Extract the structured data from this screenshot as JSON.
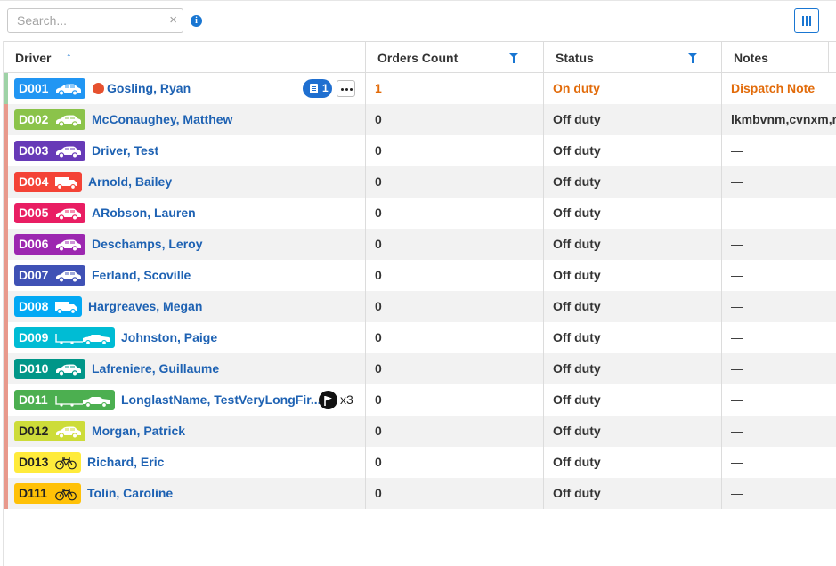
{
  "toolbar": {
    "search_placeholder": "Search...",
    "clear_glyph": "×",
    "info_glyph": "i",
    "info_icon": "info-icon",
    "columns_icon": "columns-icon"
  },
  "colors": {
    "accent": "#1976d2",
    "orange": "#e26b0a",
    "link": "#1e62b3",
    "stripe_on": "#9ed2a6",
    "stripe_off": "#e8998c"
  },
  "columns": [
    {
      "label": "Driver",
      "sort": "ascending"
    },
    {
      "label": "Orders Count",
      "filter": true
    },
    {
      "label": "Status",
      "filter": true
    },
    {
      "label": "Notes"
    }
  ],
  "sort_glyph": "↑",
  "drivers": [
    {
      "code": "D001",
      "vehicle": "car",
      "color": "#2196f3",
      "text_dark": false,
      "name": "Gosling, Ryan",
      "status_dot": "#e6512f",
      "order_badge": "1",
      "more": "more-options",
      "orders": "1",
      "status": "On duty",
      "notes": "Dispatch Note",
      "highlight": true
    },
    {
      "code": "D002",
      "vehicle": "car",
      "color": "#8bc34a",
      "text_dark": false,
      "name": "McConaughey, Matthew",
      "orders": "0",
      "status": "Off duty",
      "notes": "lkmbvnm,cvnxm,n"
    },
    {
      "code": "D003",
      "vehicle": "car",
      "color": "#673ab7",
      "text_dark": false,
      "name": "Driver, Test",
      "orders": "0",
      "status": "Off duty",
      "notes": "—"
    },
    {
      "code": "D004",
      "vehicle": "truck",
      "color": "#f44336",
      "text_dark": false,
      "name": "Arnold, Bailey",
      "orders": "0",
      "status": "Off duty",
      "notes": "—"
    },
    {
      "code": "D005",
      "vehicle": "car",
      "color": "#e91e63",
      "text_dark": false,
      "name": "ARobson, Lauren",
      "orders": "0",
      "status": "Off duty",
      "notes": "—"
    },
    {
      "code": "D006",
      "vehicle": "car",
      "color": "#9c27b0",
      "text_dark": false,
      "name": "Deschamps, Leroy",
      "orders": "0",
      "status": "Off duty",
      "notes": "—"
    },
    {
      "code": "D007",
      "vehicle": "car",
      "color": "#3f51b5",
      "text_dark": false,
      "name": "Ferland, Scoville",
      "orders": "0",
      "status": "Off duty",
      "notes": "—"
    },
    {
      "code": "D008",
      "vehicle": "truck",
      "color": "#03a9f4",
      "text_dark": false,
      "name": "Hargreaves, Megan",
      "orders": "0",
      "status": "Off duty",
      "notes": "—"
    },
    {
      "code": "D009",
      "vehicle": "trailer",
      "color": "#00bcd4",
      "text_dark": false,
      "name": "Johnston, Paige",
      "orders": "0",
      "status": "Off duty",
      "notes": "—"
    },
    {
      "code": "D010",
      "vehicle": "car",
      "color": "#009688",
      "text_dark": false,
      "name": "Lafreniere, Guillaume",
      "orders": "0",
      "status": "Off duty",
      "notes": "—"
    },
    {
      "code": "D011",
      "vehicle": "trailer",
      "color": "#4caf50",
      "text_dark": false,
      "name": "LonglastName, TestVeryLongFir...",
      "flag_icon": "flag-icon",
      "flag_count": "x3",
      "orders": "0",
      "status": "Off duty",
      "notes": "—"
    },
    {
      "code": "D012",
      "vehicle": "car",
      "color": "#cddc39",
      "text_dark": true,
      "name": "Morgan, Patrick",
      "orders": "0",
      "status": "Off duty",
      "notes": "—"
    },
    {
      "code": "D013",
      "vehicle": "bike",
      "color": "#ffeb3b",
      "text_dark": true,
      "name": "Richard, Eric",
      "orders": "0",
      "status": "Off duty",
      "notes": "—"
    },
    {
      "code": "D111",
      "vehicle": "bike",
      "color": "#ffc107",
      "text_dark": true,
      "name": "Tolin, Caroline",
      "orders": "0",
      "status": "Off duty",
      "notes": "—"
    }
  ]
}
